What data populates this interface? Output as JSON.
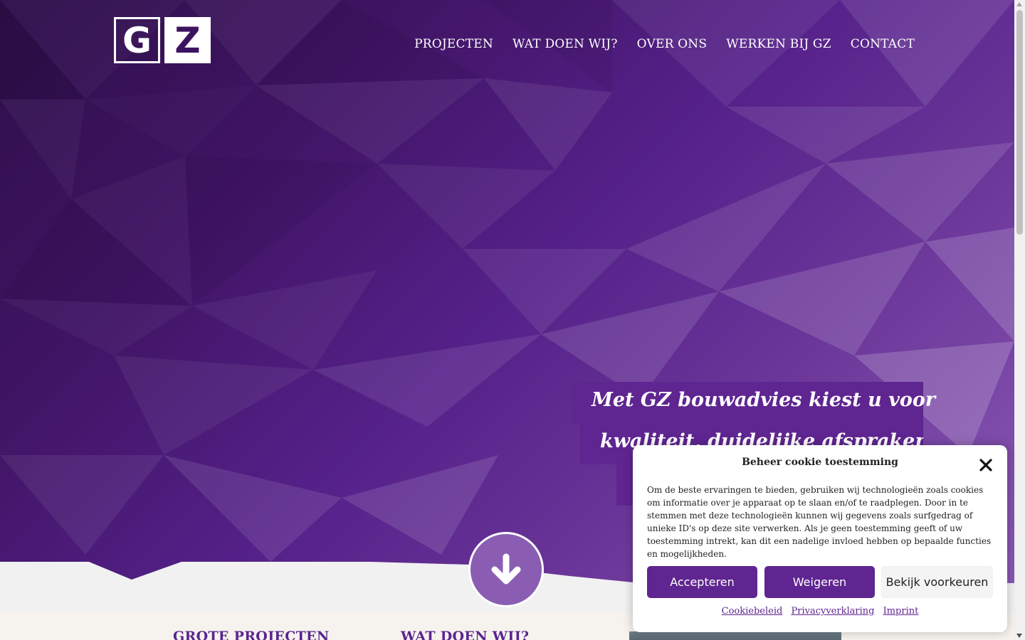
{
  "logo": {
    "letter1": "G",
    "letter2": "Z"
  },
  "nav": {
    "items": [
      {
        "label": "PROJECTEN"
      },
      {
        "label": "WAT DOEN WIJ?"
      },
      {
        "label": "OVER ONS"
      },
      {
        "label": "WERKEN BIJ GZ"
      },
      {
        "label": "CONTACT"
      }
    ]
  },
  "hero": {
    "tagline_line1": "Met GZ bouwadvies kiest u voor",
    "tagline_line2": "kwaliteit, duidelijke afspraken",
    "scroll_icon": "arrow-down-icon"
  },
  "sections": {
    "grote_projecten": "GROTE PROJECTEN",
    "wat_doen_wij": "WAT DOEN WIJ?"
  },
  "cookie": {
    "title": "Beheer cookie toestemming",
    "close_icon": "close-icon",
    "message": "Om de beste ervaringen te bieden, gebruiken wij technologieën zoals cookies om informatie over je apparaat op te slaan en/of te raadplegen. Door in te stemmen met deze technologieën kunnen wij gegevens zoals surfgedrag of unieke ID's op deze site verwerken. Als je geen toestemming geeft of uw toestemming intrekt, kan dit een nadelige invloed hebben op bepaalde functies en mogelijkheden.",
    "accept_label": "Accepteren",
    "deny_label": "Weigeren",
    "prefs_label": "Bekijk voorkeuren",
    "links": {
      "cookiebeleid": "Cookiebeleid",
      "privacy": "Privacyverklaring",
      "imprint": "Imprint"
    }
  },
  "colors": {
    "brand_purple": "#5f2590",
    "hero_dark": "#2e0f4a",
    "hero_light": "#8a5ab5"
  }
}
